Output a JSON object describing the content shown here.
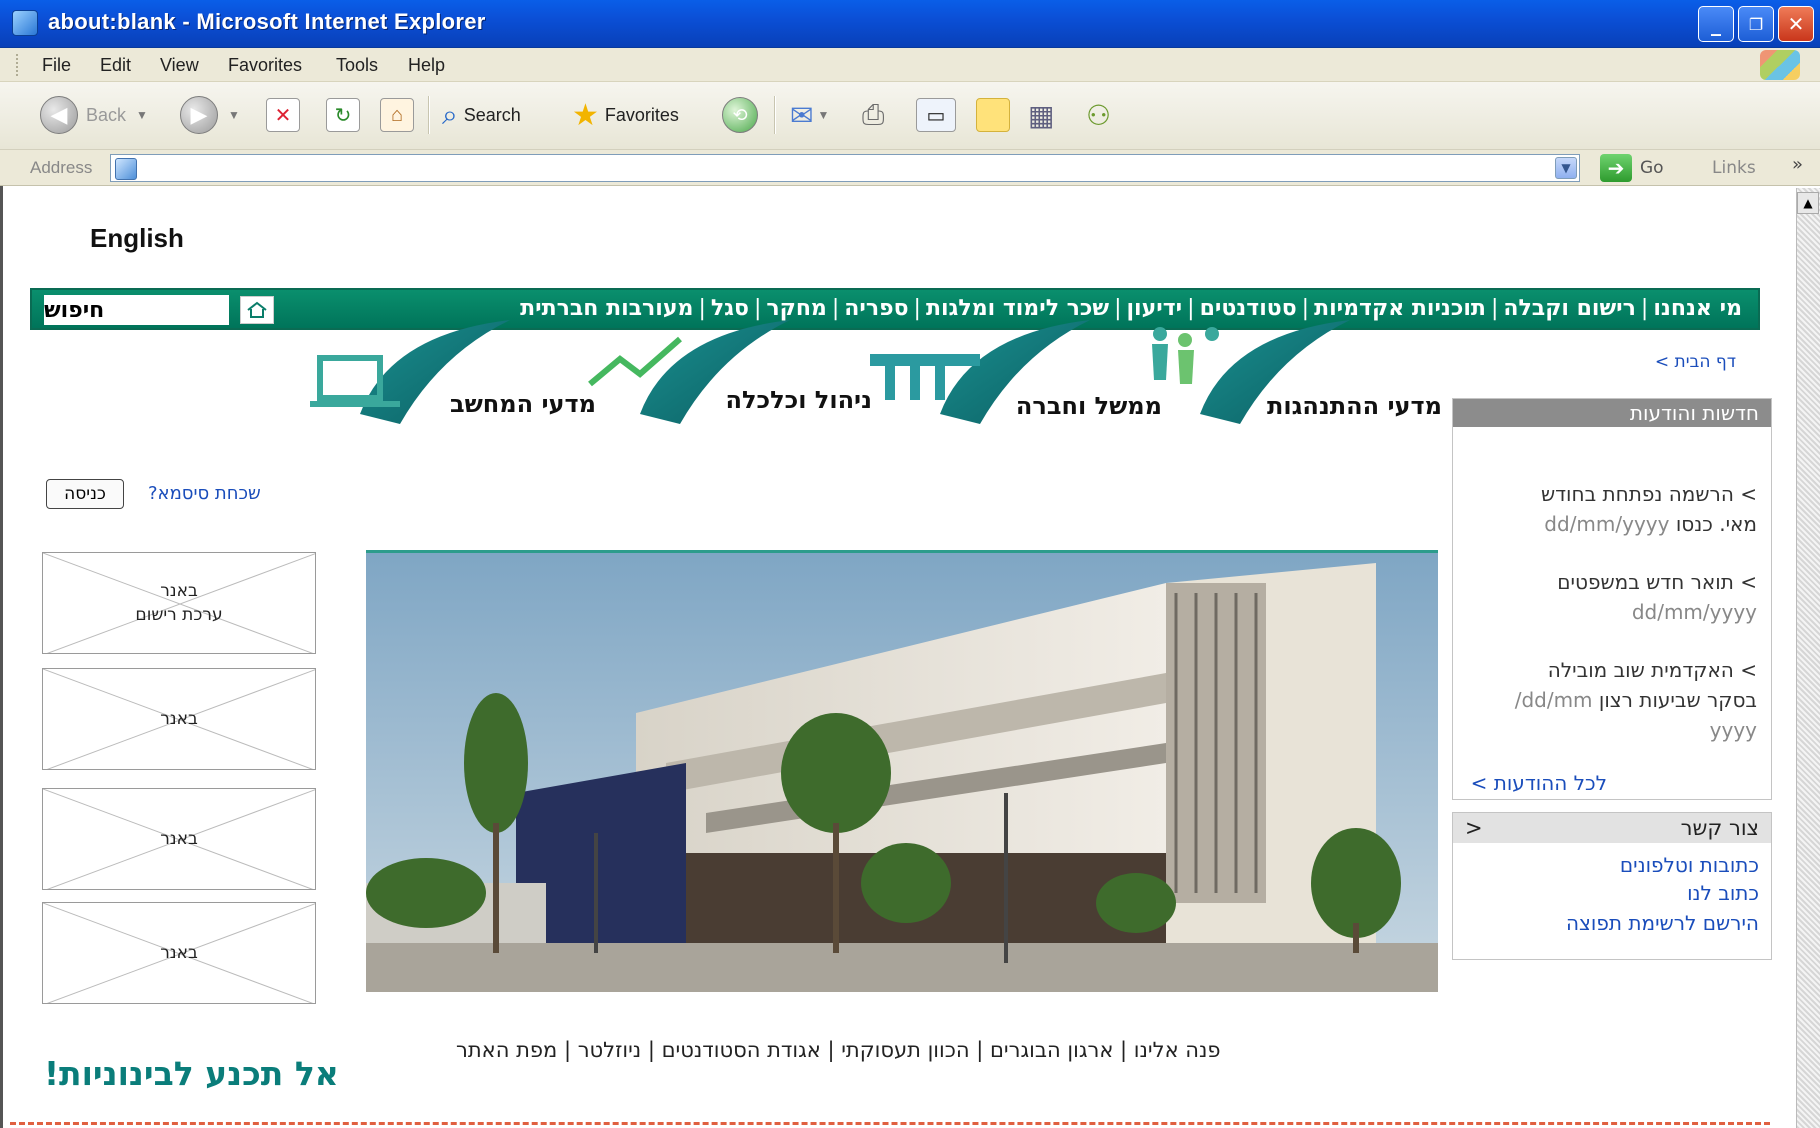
{
  "window": {
    "title": "about:blank - Microsoft Internet Explorer",
    "controls": [
      "_",
      "❐",
      "✕"
    ]
  },
  "menu": [
    "File",
    "Edit",
    "View",
    "Favorites",
    "Tools",
    "Help"
  ],
  "toolbar": {
    "back": "Back",
    "search": "Search",
    "favorites": "Favorites"
  },
  "address": {
    "label": "Address",
    "value": "",
    "go": "Go",
    "links": "Links",
    "chevron": "»"
  },
  "site": {
    "english_link": "English",
    "nav": [
      "מי אנחנו",
      "רישום וקבלה",
      "תוכניות אקדמיות",
      "סטודנטים",
      "ידיעון",
      "שכר לימוד ומלגות",
      "ספריה",
      "מחקר",
      "סגל",
      "מעורבות חברתית"
    ],
    "search_label": "חיפוש",
    "breadcrumb": "דף הבית >",
    "categories": [
      "מדעי ההתנהגות",
      "ממשל וחברה",
      "ניהול וכלכלה",
      "מדעי המחשב"
    ],
    "login_button": "כניסה",
    "forgot_password": "שכחת סיסמא?",
    "news": {
      "title": "חדשות והודעות",
      "items": [
        {
          "l1": "> הרשמה נפתחת בחודש",
          "l2": "מאי. כנסו",
          "date": "dd/mm/yyyy"
        },
        {
          "l1": "> תואר חדש במשפטים",
          "l2": "",
          "date": "dd/mm/yyyy"
        },
        {
          "l1": "> האקדמית שוב מובילה",
          "l2": "בסקר שביעות רצון",
          "date": "dd/mm/",
          "date2": "yyyy"
        }
      ],
      "all_link": "לכל ההודעות >"
    },
    "contact": {
      "title": "צור קשר",
      "arrow": "<",
      "links": [
        "כתובות וטלפונים",
        "כתוב לנו",
        "הירשם לרשימת תפוצה"
      ]
    },
    "banners": [
      {
        "line1": "באנר",
        "line2": "ערכת רישום"
      },
      {
        "line1": "באנר",
        "line2": ""
      },
      {
        "line1": "באנר",
        "line2": ""
      },
      {
        "line1": "באנר",
        "line2": ""
      }
    ],
    "footer_links": "פנה אלינו | ארגון הבוגרים | הכוון תעסוקתי | אגודת הסטודנטים | ניוזלטר | מפת האתר",
    "slogan": "אל תכנע לבינוניות!"
  },
  "colors": {
    "nav_green": "#00745a",
    "accent_teal": "#0a7d7a",
    "link_blue": "#1a4dbb",
    "xp_blue": "#0b4fd6"
  }
}
